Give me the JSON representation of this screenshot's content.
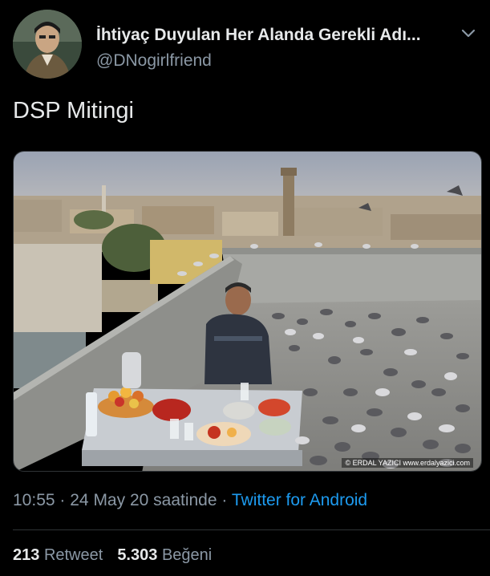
{
  "author": {
    "display_name": "İhtiyaç Duyulan Her Alanda Gerekli Adı...",
    "handle": "@DNogirlfriend",
    "avatar_icon": "profile-photo",
    "menu_icon": "chevron-down-icon"
  },
  "tweet": {
    "text": "DSP Mitingi",
    "photo": {
      "description_icon": "rooftop-pigeons-photo",
      "credit": "© ERDAL YAZICI  www.erdalyazici.com"
    }
  },
  "meta": {
    "time": "10:55",
    "separator": "·",
    "date": "24 May 20 saatinde",
    "separator2": "·",
    "source": "Twitter for Android"
  },
  "stats": {
    "retweets_count": "213",
    "retweets_label": "Retweet",
    "likes_count": "5.303",
    "likes_label": "Beğeni"
  },
  "colors": {
    "background": "#000000",
    "text_primary": "#e7e9ea",
    "text_secondary": "#8b98a5",
    "link": "#1d9bf0",
    "divider": "#2f3336"
  }
}
